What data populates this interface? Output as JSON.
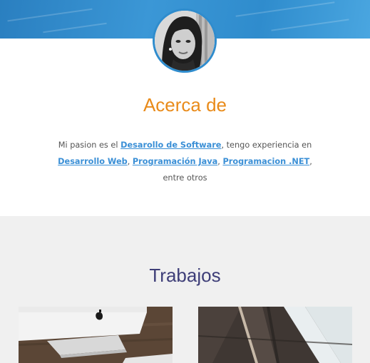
{
  "about": {
    "title": "Acerca de",
    "text_intro": "Mi pasion es el ",
    "link_software": "Desarollo de Software",
    "text_experience": ", tengo experiencia en ",
    "link_web": "Desarrollo Web",
    "sep1": ", ",
    "link_java": "Programación Java",
    "sep2": ", ",
    "link_net": "Programacion .NET",
    "text_outro": ", entre otros"
  },
  "works": {
    "title": "Trabajos"
  },
  "colors": {
    "banner": "#2f8ccd",
    "about_title": "#e98b1a",
    "works_title": "#3e3e78",
    "link": "#3a8fd6",
    "works_bg": "#f0f0f0"
  }
}
